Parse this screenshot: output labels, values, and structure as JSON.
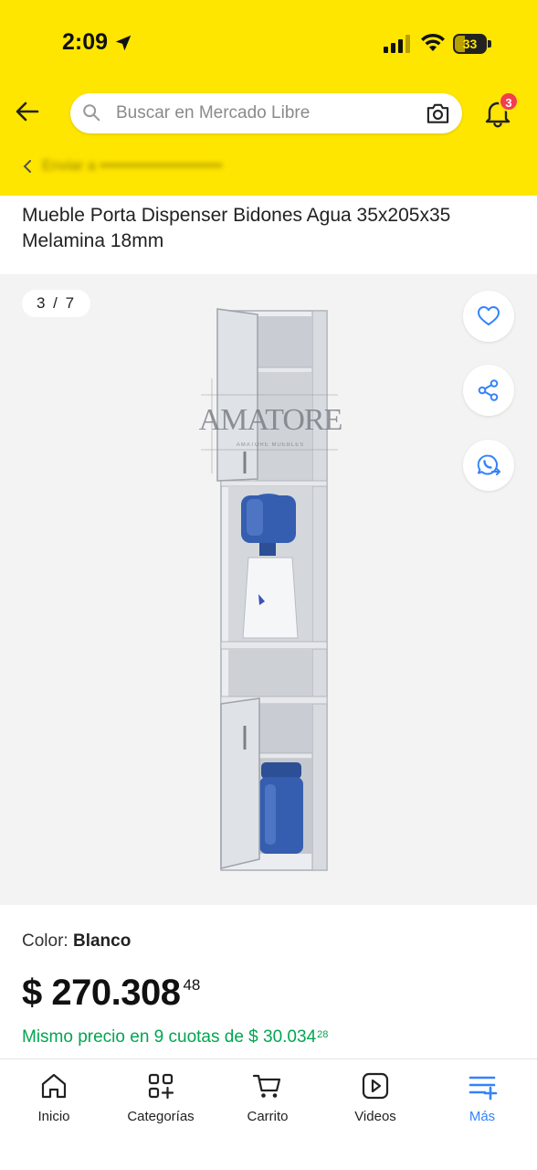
{
  "status_bar": {
    "time": "2:09",
    "battery_level": "33",
    "battery_percent": 33
  },
  "header": {
    "back_icon": "arrow-left-icon",
    "search": {
      "placeholder": "Buscar en Mercado Libre",
      "value": ""
    },
    "camera_icon": "camera-icon",
    "notifications": {
      "icon": "bell-icon",
      "count": "3"
    },
    "location": {
      "icon": "location-pin-icon",
      "text": "Enviar a ••••••••••••••••••••••••"
    }
  },
  "product": {
    "title": "Mueble Porta Dispenser Bidones Agua 35x205x35 Melamina 18mm",
    "gallery": {
      "counter": "3 / 7",
      "current_image": 3,
      "total_images": 7,
      "watermark": "AMATORE",
      "watermark_subtitle": "AMATORE MUEBLES"
    },
    "actions": {
      "favorite_icon": "heart-icon",
      "share_icon": "share-icon",
      "whatsapp_icon": "whatsapp-icon"
    },
    "color_label": "Color: ",
    "color_value": "Blanco",
    "price": {
      "main": "$ 270.308",
      "cents": "48"
    },
    "installments": {
      "text": "Mismo precio en 9 cuotas de $ 30.034",
      "cents": "28"
    }
  },
  "bottom_nav": {
    "items": [
      {
        "label": "Inicio",
        "icon": "home-icon",
        "active": false
      },
      {
        "label": "Categorías",
        "icon": "categories-icon",
        "active": false
      },
      {
        "label": "Carrito",
        "icon": "cart-icon",
        "active": false
      },
      {
        "label": "Videos",
        "icon": "video-icon",
        "active": false
      },
      {
        "label": "Más",
        "icon": "more-menu-icon",
        "active": true
      }
    ]
  },
  "colors": {
    "header_yellow": "#ffe600",
    "accent_blue": "#3483fa",
    "installments_green": "#00a650",
    "badge_red": "#f23d4f",
    "gallery_bg": "#f3f3f3"
  }
}
